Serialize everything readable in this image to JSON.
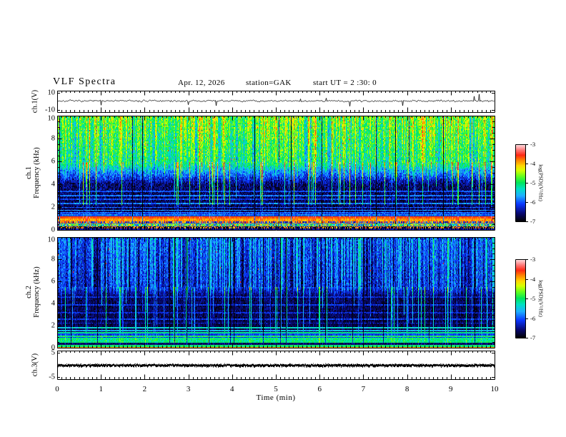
{
  "header": {
    "title": "VLF Spectra",
    "date": "Apr. 12, 2026",
    "station": "station=GAK",
    "start_ut": "start UT =  2 :30: 0"
  },
  "x_axis": {
    "label": "Time  (min)",
    "tick_labels": [
      "0",
      "1",
      "2",
      "3",
      "4",
      "5",
      "6",
      "7",
      "8",
      "9",
      "10"
    ],
    "range_min": [
      0,
      10
    ],
    "minor_tick_step_min": 0.1
  },
  "colorbar": {
    "label": "log(PSD)(V²/Hz)",
    "tick_labels": [
      "-3",
      "-4",
      "-5",
      "-6",
      "-7"
    ],
    "range": [
      -7,
      -3
    ]
  },
  "chart_data": {
    "type": "heatmap",
    "title": "VLF Spectra",
    "x": {
      "label": "Time  (min)",
      "range": [
        0,
        10
      ],
      "units": "min"
    },
    "colormap": {
      "range": [
        -7,
        -3
      ],
      "stops": [
        [
          0.0,
          [
            2,
            2,
            8
          ]
        ],
        [
          0.1,
          [
            8,
            8,
            115
          ]
        ],
        [
          0.22,
          [
            10,
            55,
            255
          ]
        ],
        [
          0.33,
          [
            30,
            175,
            255
          ]
        ],
        [
          0.42,
          [
            0,
            225,
            195
          ]
        ],
        [
          0.5,
          [
            0,
            230,
            90
          ]
        ],
        [
          0.58,
          [
            95,
            255,
            30
          ]
        ],
        [
          0.66,
          [
            215,
            255,
            0
          ]
        ],
        [
          0.72,
          [
            255,
            215,
            0
          ]
        ],
        [
          0.79,
          [
            255,
            135,
            0
          ]
        ],
        [
          0.86,
          [
            255,
            40,
            20
          ]
        ],
        [
          0.93,
          [
            255,
            125,
            125
          ]
        ],
        [
          1.0,
          [
            255,
            228,
            232
          ]
        ]
      ]
    },
    "panels": [
      {
        "id": "ch1_waveform",
        "type": "line",
        "ylabel": "ch.1(V)",
        "ylim": [
          -10,
          10
        ],
        "ytick_values": [
          10,
          -10
        ],
        "ytick_labels": [
          "10",
          "-10"
        ],
        "summary": "noisy broadband waveform centered near 0 V with impulsive spikes up to about ±8 V",
        "signal": {
          "baseline": 0.5,
          "sigma": 0.7,
          "spike_prob": 0.02,
          "spike_min": 2,
          "spike_max": 7
        }
      },
      {
        "id": "ch1_spectrogram",
        "type": "heatmap",
        "ylabel": "ch.1 Frequency (kHz)",
        "ylabel_lines": [
          "ch.1",
          "Frequency  (kHz)"
        ],
        "ylim": [
          0,
          10
        ],
        "yticks": [
          0,
          2,
          4,
          6,
          8,
          10
        ],
        "summary": "bright green broadband hiss above ~6 kHz with dense vertical sferic streaks reaching down to 2-5 kHz; dark floor 1.5-6 kHz crossed by faint blue horizontal hum lines; intense orange/red band near 0.8-1.2 kHz and mottled red/green rows below 0.8 kHz",
        "features": {
          "ylim": [
            0,
            10
          ],
          "high_band": {
            "fmin": 6,
            "fmax": 10,
            "level": -4.75,
            "grad": 0.1,
            "col_var": 0.75,
            "noise": 0.45,
            "red_speckle": 0.004
          },
          "transition": [
            4,
            6
          ],
          "floor": {
            "level": -6.72,
            "noise": 0.35
          },
          "sferics": {
            "col_prob": 0.13,
            "strength": [
              0.5,
              1.4
            ],
            "depth_kHz": [
              2.2,
              5.5
            ],
            "boost": 1.5,
            "weak_boost": 0.35
          },
          "dropouts": {
            "col_prob": 0.025,
            "delta": -2.0
          },
          "h_lines": [
            [
              3.4,
              -6.05
            ],
            [
              3.05,
              -5.9
            ],
            [
              2.7,
              -6.1
            ],
            [
              2.35,
              -5.85
            ],
            [
              2.0,
              -6.0
            ],
            [
              1.75,
              -5.75
            ],
            [
              1.55,
              -5.95
            ],
            [
              1.35,
              -5.85
            ]
          ],
          "low_bands": [
            {
              "f": [
                1.2,
                1.55
              ],
              "mode": "noise",
              "level": -6.35,
              "noise": 0.3
            },
            {
              "f": [
                1.02,
                1.2
              ],
              "mode": "noise",
              "level": -3.7,
              "noise": 0.15
            },
            {
              "f": [
                0.78,
                1.02
              ],
              "mode": "noise",
              "level": -3.95,
              "noise": 0.18
            },
            {
              "f": [
                0.58,
                0.78
              ],
              "mode": "mottle",
              "hi": -3.9,
              "lo": -6.2,
              "p": 0.5
            },
            {
              "f": [
                0.32,
                0.58
              ],
              "mode": "speckle",
              "min": -6.4,
              "max": -3.8
            },
            {
              "f": [
                0.13,
                0.32
              ],
              "mode": "mottle",
              "hi": -3.85,
              "lo": -6.8,
              "p": 0.4
            },
            {
              "f": [
                0.0,
                0.13
              ],
              "mode": "noise",
              "level": -6.5,
              "noise": 0.3
            }
          ]
        }
      },
      {
        "id": "ch2_spectrogram",
        "type": "heatmap",
        "ylabel": "ch.2 Frequency (kHz)",
        "ylabel_lines": [
          "ch.2",
          "Frequency  (kHz)"
        ],
        "ylim": [
          0,
          10
        ],
        "yticks": [
          0,
          2,
          4,
          6,
          8,
          10
        ],
        "summary": "mostly dark blue background with long cyan/green vertical sferic streaks spanning 0.5-10 kHz; striped blue texture above ~5.5 kHz; green horizontal lines near 1.4-1.9 kHz; bright green band 0.5-0.95 kHz and red line at the very bottom",
        "features": {
          "ylim": [
            0,
            10
          ],
          "high_band": {
            "fmin": 5.5,
            "fmax": 10,
            "level": -6.0,
            "grad": 0.05,
            "col_var": 0.8,
            "noise": 0.35,
            "red_speckle": 0.001
          },
          "transition": [
            4.6,
            5.5
          ],
          "floor": {
            "level": -6.8,
            "noise": 0.25
          },
          "sferics": {
            "col_prob": 0.17,
            "strength": [
              0.4,
              1.35
            ],
            "depth_kHz": [
              0.6,
              4.5
            ],
            "boost": 1.3,
            "weak_boost": 0.3
          },
          "dropouts": {
            "col_prob": 0.02,
            "delta": -1.3
          },
          "h_lines": [
            [
              4.6,
              -6.25
            ],
            [
              3.9,
              -6.2
            ],
            [
              3.2,
              -6.3
            ],
            [
              2.6,
              -6.2
            ],
            [
              2.25,
              -6.35
            ],
            [
              1.85,
              -5.4
            ],
            [
              1.6,
              -5.6
            ],
            [
              1.4,
              -5.15
            ],
            [
              1.08,
              -5.0
            ]
          ],
          "low_bands": [
            {
              "f": [
                0.95,
                1.35
              ],
              "mode": "noise",
              "level": -6.15,
              "noise": 0.25
            },
            {
              "f": [
                0.5,
                0.95
              ],
              "mode": "noise",
              "level": -5.15,
              "noise": 0.3
            },
            {
              "f": [
                0.28,
                0.5
              ],
              "mode": "noise",
              "level": -6.7,
              "noise": 0.2
            },
            {
              "f": [
                0.12,
                0.28
              ],
              "mode": "noise",
              "level": -5.05,
              "noise": 0.25
            },
            {
              "f": [
                0.0,
                0.12
              ],
              "mode": "noise",
              "level": -3.95,
              "noise": 0.15
            }
          ]
        }
      },
      {
        "id": "ch3_waveform",
        "type": "line",
        "ylabel": "ch.3(V)",
        "ylim": [
          -5,
          5
        ],
        "ytick_values": [
          5,
          -5
        ],
        "ytick_labels": [
          "5",
          "-5"
        ],
        "summary": "flat thick fuzzy black trace at 0 V for the whole 10 minutes (no signal)",
        "signal": {
          "level": 0,
          "thickness": 3
        }
      }
    ]
  }
}
